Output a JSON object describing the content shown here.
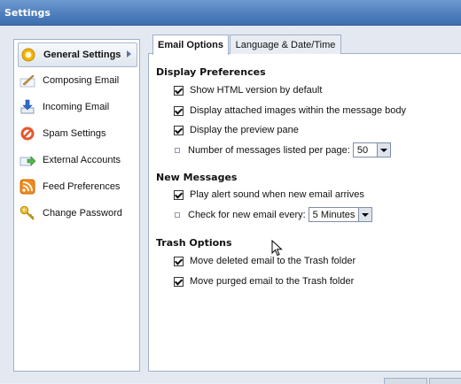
{
  "window": {
    "title": "Settings"
  },
  "sidebar": {
    "items": [
      {
        "label": "General Settings",
        "icon": "gear-icon",
        "active": true
      },
      {
        "label": "Composing Email",
        "icon": "pencil-icon"
      },
      {
        "label": "Incoming Email",
        "icon": "download-arrow-icon"
      },
      {
        "label": "Spam Settings",
        "icon": "block-icon"
      },
      {
        "label": "External Accounts",
        "icon": "external-accounts-icon"
      },
      {
        "label": "Feed Preferences",
        "icon": "rss-feed-icon"
      },
      {
        "label": "Change Password",
        "icon": "key-icon"
      }
    ]
  },
  "tabs": [
    {
      "label": "Email Options",
      "active": true
    },
    {
      "label": "Language & Date/Time",
      "active": false
    }
  ],
  "display_preferences": {
    "title": "Display Preferences",
    "show_html": {
      "label": "Show HTML version by default",
      "checked": true
    },
    "display_images": {
      "label": "Display attached images within the message body",
      "checked": true
    },
    "preview_pane": {
      "label": "Display the preview pane",
      "checked": true
    },
    "messages_per_page": {
      "label": "Number of messages listed per page:",
      "value": "50"
    }
  },
  "new_messages": {
    "title": "New Messages",
    "alert_sound": {
      "label": "Play alert sound when new email arrives",
      "checked": true
    },
    "check_every": {
      "label": "Check for new email every:",
      "value": "5 Minutes"
    }
  },
  "trash_options": {
    "title": "Trash Options",
    "move_deleted": {
      "label": "Move deleted email to the Trash folder",
      "checked": true
    },
    "move_purged": {
      "label": "Move purged email to the Trash folder",
      "checked": true
    }
  }
}
